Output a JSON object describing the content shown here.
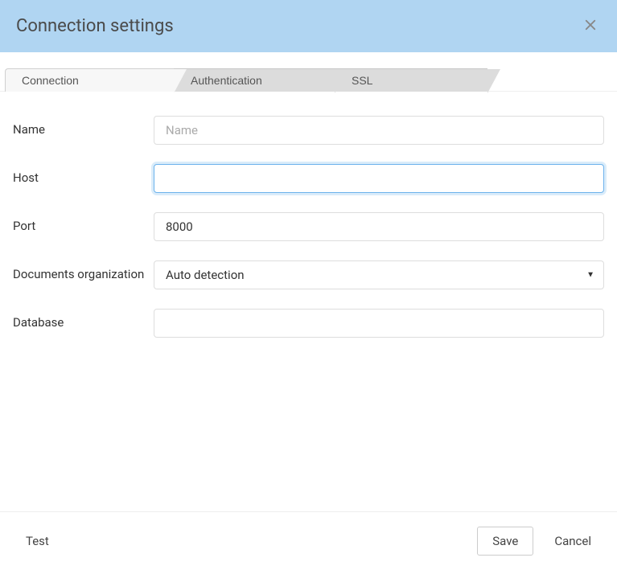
{
  "header": {
    "title": "Connection settings"
  },
  "tabs": [
    {
      "label": "Connection"
    },
    {
      "label": "Authentication"
    },
    {
      "label": "SSL"
    }
  ],
  "form": {
    "name": {
      "label": "Name",
      "placeholder": "Name",
      "value": ""
    },
    "host": {
      "label": "Host",
      "placeholder": "",
      "value": ""
    },
    "port": {
      "label": "Port",
      "placeholder": "",
      "value": "8000"
    },
    "docs_org": {
      "label": "Documents organization",
      "selected": "Auto detection"
    },
    "database": {
      "label": "Database",
      "placeholder": "",
      "value": ""
    }
  },
  "footer": {
    "test": "Test",
    "save": "Save",
    "cancel": "Cancel"
  }
}
